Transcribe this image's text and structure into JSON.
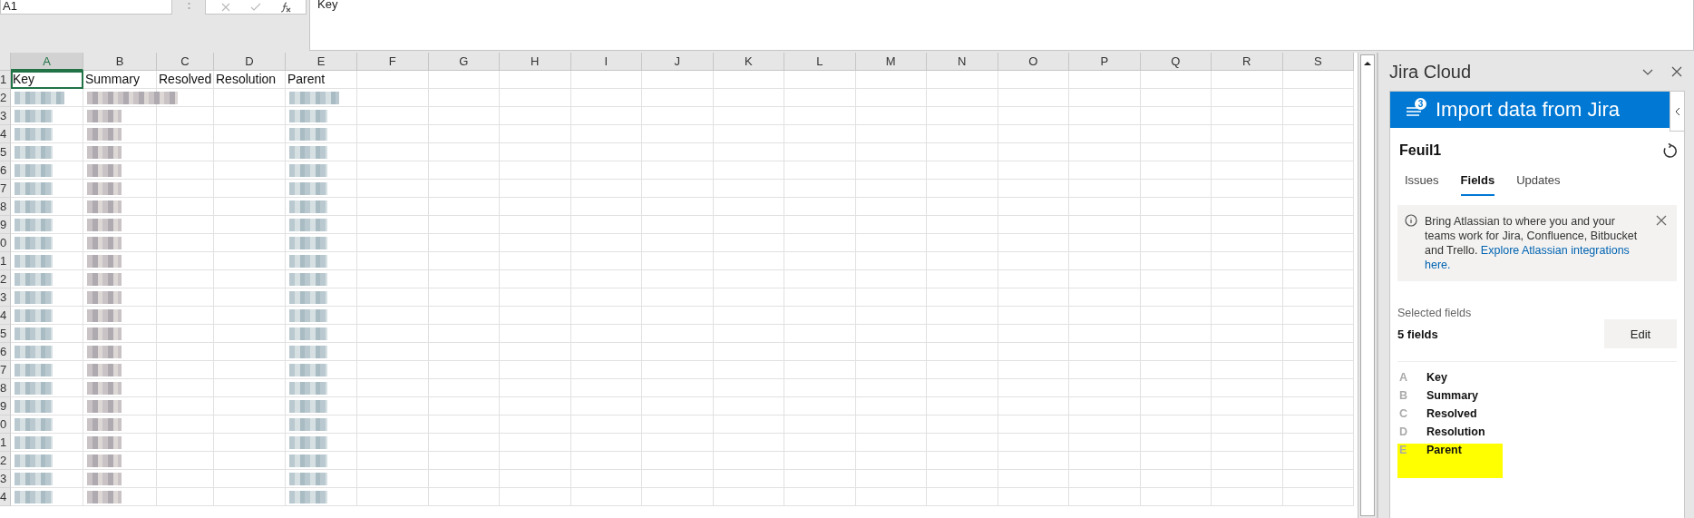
{
  "name_box": {
    "value": "A1"
  },
  "formula_bar": {
    "value": "Key"
  },
  "columns": [
    {
      "label": "A",
      "selected": true
    },
    {
      "label": "B",
      "selected": false
    },
    {
      "label": "C",
      "selected": false
    },
    {
      "label": "D",
      "selected": false
    },
    {
      "label": "E",
      "selected": false
    },
    {
      "label": "F",
      "selected": false
    },
    {
      "label": "G",
      "selected": false
    },
    {
      "label": "H",
      "selected": false
    },
    {
      "label": "I",
      "selected": false
    },
    {
      "label": "J",
      "selected": false
    },
    {
      "label": "K",
      "selected": false
    },
    {
      "label": "L",
      "selected": false
    },
    {
      "label": "M",
      "selected": false
    },
    {
      "label": "N",
      "selected": false
    },
    {
      "label": "O",
      "selected": false
    },
    {
      "label": "P",
      "selected": false
    },
    {
      "label": "Q",
      "selected": false
    },
    {
      "label": "R",
      "selected": false
    },
    {
      "label": "S",
      "selected": false
    }
  ],
  "header_row": {
    "number": "1",
    "cells": [
      {
        "text": "Key",
        "selected": true
      },
      {
        "text": "Summary",
        "selected": false
      },
      {
        "text": "Resolved",
        "selected": false
      },
      {
        "text": "Resolution",
        "selected": false
      },
      {
        "text": "Parent",
        "selected": false
      }
    ]
  },
  "data_rows": [
    {
      "number": "2",
      "redacted": true
    },
    {
      "number": "3",
      "redacted": true
    },
    {
      "number": "4",
      "redacted": true
    },
    {
      "number": "5",
      "redacted": true
    },
    {
      "number": "6",
      "redacted": true
    },
    {
      "number": "7",
      "redacted": true
    },
    {
      "number": "8",
      "redacted": true
    },
    {
      "number": "9",
      "redacted": true
    },
    {
      "number": "0",
      "redacted": true
    },
    {
      "number": "1",
      "redacted": true
    },
    {
      "number": "2",
      "redacted": true
    },
    {
      "number": "3",
      "redacted": true
    },
    {
      "number": "4",
      "redacted": true
    },
    {
      "number": "5",
      "redacted": true
    },
    {
      "number": "6",
      "redacted": true
    },
    {
      "number": "7",
      "redacted": true
    },
    {
      "number": "8",
      "redacted": true
    },
    {
      "number": "9",
      "redacted": true
    },
    {
      "number": "0",
      "redacted": true
    },
    {
      "number": "1",
      "redacted": true
    },
    {
      "number": "2",
      "redacted": true
    },
    {
      "number": "3",
      "redacted": true
    },
    {
      "number": "4",
      "redacted": true
    }
  ],
  "panel": {
    "title": "Jira Cloud",
    "banner": {
      "title": "Import data from Jira",
      "badge": "3"
    },
    "sheet": "Feuil1",
    "tabs": [
      {
        "label": "Issues",
        "selected": false
      },
      {
        "label": "Fields",
        "selected": true
      },
      {
        "label": "Updates",
        "selected": false
      }
    ],
    "notice": {
      "text": "Bring Atlassian to where you and your teams work for Jira, Confluence, Bitbucket and Trello.",
      "link": "Explore Atlassian integrations here."
    },
    "selected_fields": {
      "label": "Selected fields",
      "count": "5 fields",
      "button": "Edit"
    },
    "fields": [
      {
        "column": "A",
        "name": "Key",
        "highlighted": false
      },
      {
        "column": "B",
        "name": "Summary",
        "highlighted": false
      },
      {
        "column": "C",
        "name": "Resolved",
        "highlighted": false
      },
      {
        "column": "D",
        "name": "Resolution",
        "highlighted": false
      },
      {
        "column": "E",
        "name": "Parent",
        "highlighted": true
      }
    ]
  }
}
